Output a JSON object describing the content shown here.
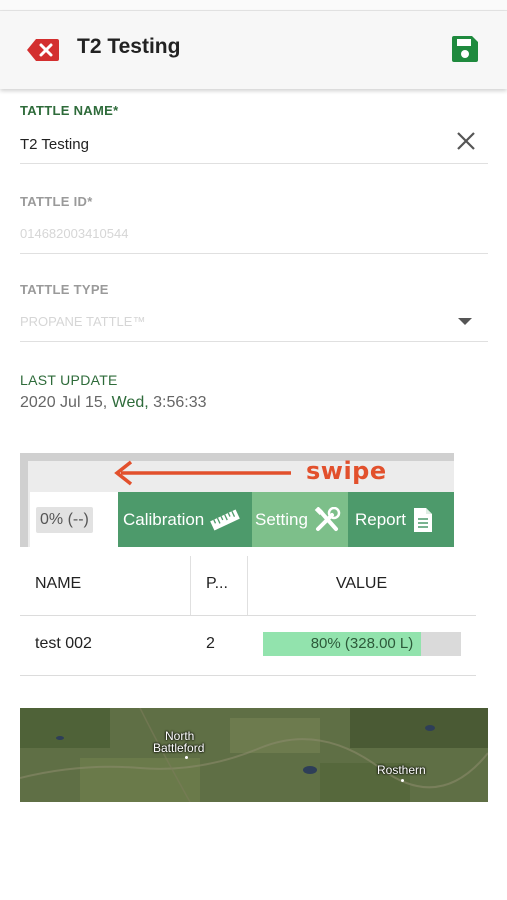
{
  "appbar": {
    "title": "T2 Testing"
  },
  "fields": {
    "name": {
      "label": "TATTLE NAME*",
      "value": "T2 Testing"
    },
    "id": {
      "label": "TATTLE ID*",
      "value": "014682003410544"
    },
    "type": {
      "label": "TATTLE TYPE",
      "value": "PROPANE TATTLE™"
    },
    "last_update": {
      "label": "LAST UPDATE",
      "date": "2020 Jul 15,",
      "day": "Wed,",
      "time": "3:56:33"
    }
  },
  "overlay": {
    "swipe_text": "swipe"
  },
  "tabs": {
    "status": "0% (--)",
    "calibration": "Calibration",
    "setting": "Setting",
    "report": "Report"
  },
  "table": {
    "headers": [
      "NAME",
      "P...",
      "VALUE"
    ],
    "rows": [
      {
        "name": "test 002",
        "p": "2",
        "value_text": "80% (328.00 L)",
        "fill_fraction": 0.8
      }
    ]
  },
  "map": {
    "labels": [
      "North",
      "Battleford",
      "Rosthern"
    ]
  },
  "colors": {
    "accent_green": "#2e6b3a",
    "tab_green": "#4d9a6b",
    "swipe_red": "#e2502c",
    "delete_red": "#d32f2f",
    "save_green": "#1f8a3e"
  }
}
